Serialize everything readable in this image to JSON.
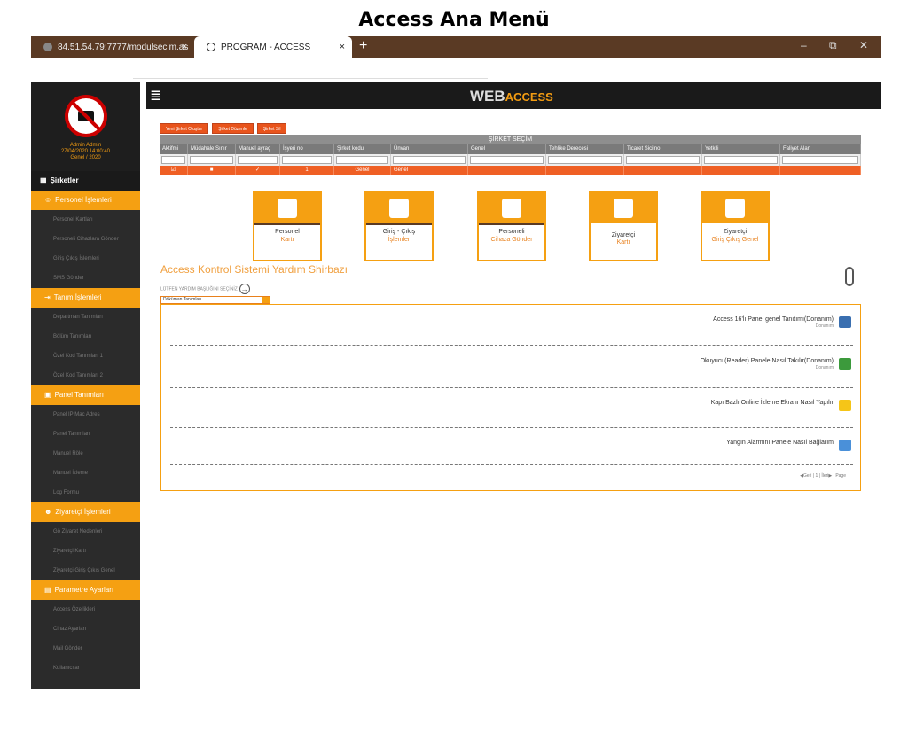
{
  "page_title": "Access Ana Menü",
  "browser": {
    "tab1_title": "84.51.54.79:7777/modulsecim.as",
    "tab2_title": "PROGRAM - ACCESS",
    "new_tab": "+",
    "close": "×",
    "minimize": "–",
    "restore": "⧉",
    "win_close": "✕"
  },
  "sidebar": {
    "user_name": "Admin Admin",
    "date": "27/04/2020 14:00:40",
    "period": "Genel / 2020",
    "sections": [
      {
        "label": "Şirketler",
        "items": []
      },
      {
        "label": "Personel İşlemleri",
        "items": [
          "Personel Kartları",
          "Personeli Cihazlara Gönder",
          "Giriş Çıkış İşlemleri",
          "SMS Gönder"
        ]
      },
      {
        "label": "Tanım İşlemleri",
        "items": [
          "Departman Tanımları",
          "Bölüm Tanımları",
          "Özel Kod Tanımları 1",
          "Özel Kod Tanımları 2"
        ]
      },
      {
        "label": "Panel Tanımları",
        "items": [
          "Panel IP Mac Adres",
          "Panel Tanımları",
          "Manuel Röle",
          "Manuel İzleme",
          "Log Formu"
        ]
      },
      {
        "label": "Ziyaretçi İşlemleri",
        "items": [
          "Gö Ziyaret Nedenleri",
          "Ziyaretçi Kartı",
          "Ziyaretçi Giriş Çıkış Genel"
        ]
      },
      {
        "label": "Parametre Ayarları",
        "items": [
          "Access Özellikleri",
          "Cihaz Ayarları",
          "Mail Gönder",
          "Kullanıcılar"
        ]
      }
    ]
  },
  "topbar": {
    "menu_icon": "≣",
    "brand_main": "WEB",
    "brand_accent": "ACCESS"
  },
  "toolbar": {
    "new_company": "Yeni Şirket Oluştur",
    "edit_company": "Şirket Düzenle",
    "delete_company": "Şirket Sil"
  },
  "grid": {
    "caption": "ŞİRKET SEÇİM",
    "columns": [
      "Aktifmi",
      "Müdahale Sınır",
      "Manuel ayraç",
      "İşyeri no",
      "Şirket kodu",
      "Ünvan",
      "Genel",
      "Tehlike Derecesi",
      "Ticaret Sicilno",
      "Yetkili",
      "Faliyet Alan"
    ],
    "row": [
      "☑",
      "■",
      "✓",
      "1",
      "Genel",
      "Genel",
      "",
      "",
      "",
      "",
      ""
    ]
  },
  "tiles": [
    {
      "line1": "Personel",
      "line2": "Kartı"
    },
    {
      "line1": "Giriş - Çıkış",
      "line2": "İşlemler"
    },
    {
      "line1": "Personeli",
      "line2": "Cihaza Gönder"
    },
    {
      "line1": "Ziyaretçi",
      "line2": "Kartı"
    },
    {
      "line1": "Ziyaretçi",
      "line2": "Giriş Çıkış Genel"
    }
  ],
  "help": {
    "title": "Access Kontrol Sistemi Yardım Shirbazı",
    "subtitle": "LÜTFEN YARDIM BAŞLIĞINI SEÇİNİZ",
    "select_value": "Döküman Tanımları",
    "items": [
      {
        "title": "Access 16'lı Panel genel Tanıtımı(Donanım)",
        "sub": "Donanım",
        "color": "#3a6fb0"
      },
      {
        "title": "Okuyucu(Reader) Panele Nasıl Takılır(Donanım)",
        "sub": "Donanım",
        "color": "#3c9a3c"
      },
      {
        "title": "Kapı Bazlı Online İzleme Ekranı Nasıl Yapılır",
        "sub": "",
        "color": "#f5c518"
      },
      {
        "title": "Yangın Alarmını Panele Nasıl Bağlarım",
        "sub": "",
        "color": "#4a90d9"
      }
    ],
    "pager": "◀Geri | 1 | İleri▶ | Page"
  },
  "colors": {
    "accent": "#f5a012",
    "grid_row": "#ef5f24",
    "tabbar": "#5a3a24"
  }
}
